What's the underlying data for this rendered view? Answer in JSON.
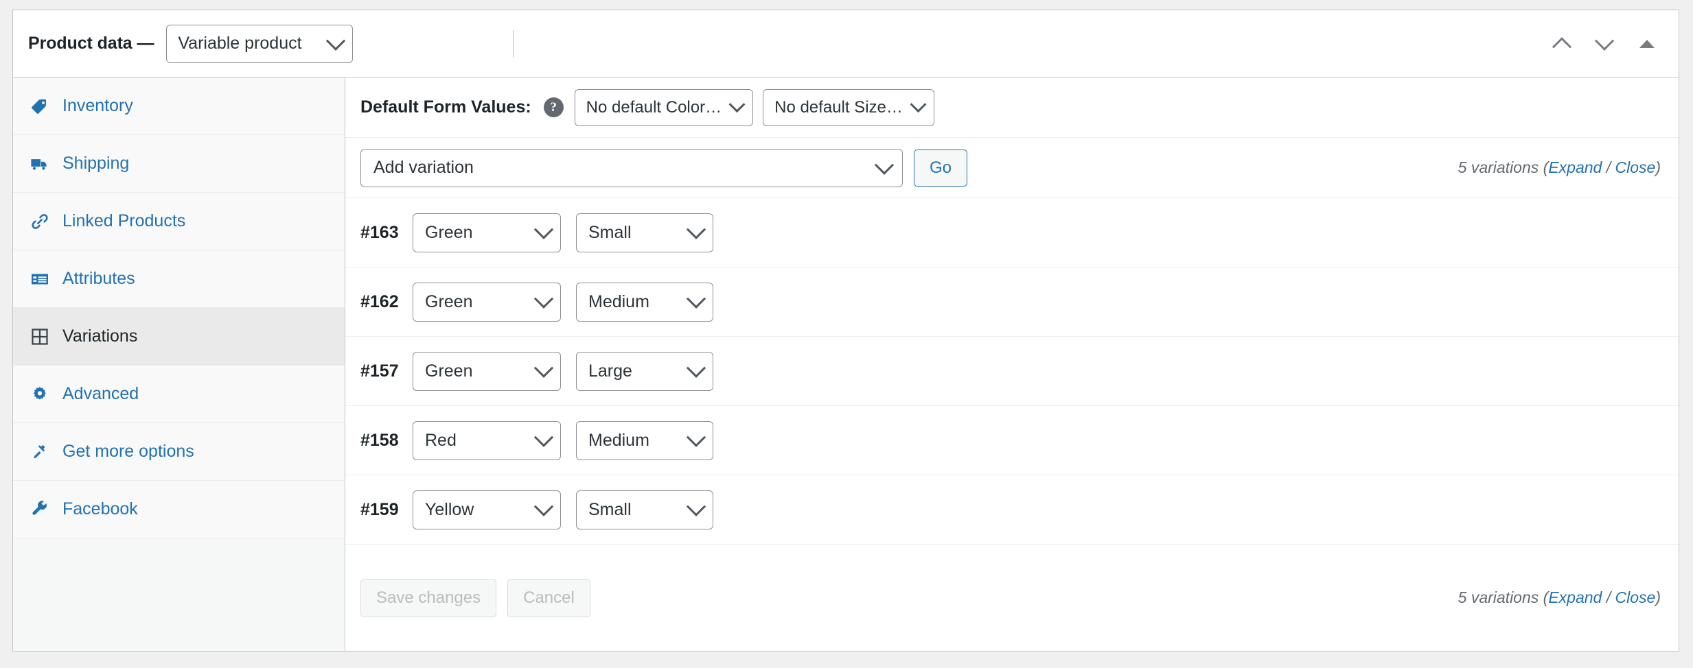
{
  "header": {
    "title": "Product data —",
    "product_type": "Variable product",
    "controls": [
      {
        "name": "move-up",
        "icon": "chevron-up-icon"
      },
      {
        "name": "move-down",
        "icon": "chevron-down-icon"
      },
      {
        "name": "toggle-panel",
        "icon": "triangle-up-icon"
      }
    ]
  },
  "sidebar": {
    "items": [
      {
        "label": "Inventory",
        "icon": "tag-icon",
        "active": false
      },
      {
        "label": "Shipping",
        "icon": "truck-icon",
        "active": false
      },
      {
        "label": "Linked Products",
        "icon": "link-icon",
        "active": false
      },
      {
        "label": "Attributes",
        "icon": "list-view-icon",
        "active": false
      },
      {
        "label": "Variations",
        "icon": "grid-icon",
        "active": true
      },
      {
        "label": "Advanced",
        "icon": "gear-icon",
        "active": false
      },
      {
        "label": "Get more options",
        "icon": "plugin-icon",
        "active": false
      },
      {
        "label": "Facebook",
        "icon": "wrench-icon",
        "active": false
      }
    ]
  },
  "main": {
    "defaults": {
      "label": "Default Form Values:",
      "help_icon": "?",
      "color_select": "No default Color…",
      "size_select": "No default Size…"
    },
    "toolbar": {
      "add_variation_select": "Add variation",
      "go_button": "Go"
    },
    "variation_count": {
      "text": "5 variations",
      "open_paren": "(",
      "expand": "Expand",
      "separator": "/",
      "close": "Close",
      "close_paren": ")"
    },
    "variations": [
      {
        "id": "#163",
        "color": "Green",
        "size": "Small"
      },
      {
        "id": "#162",
        "color": "Green",
        "size": "Medium"
      },
      {
        "id": "#157",
        "color": "Green",
        "size": "Large"
      },
      {
        "id": "#158",
        "color": "Red",
        "size": "Medium"
      },
      {
        "id": "#159",
        "color": "Yellow",
        "size": "Small"
      }
    ],
    "footer": {
      "save_label": "Save changes",
      "cancel_label": "Cancel"
    }
  },
  "colors": {
    "link": "#2271b1",
    "text": "#1d2327",
    "muted": "#646970",
    "border": "#c3c4c7",
    "panel_bg": "#ffffff",
    "sidebar_bg": "#f9f9f9",
    "active_bg": "#eaeaea",
    "page_bg": "#f0f0f1"
  }
}
